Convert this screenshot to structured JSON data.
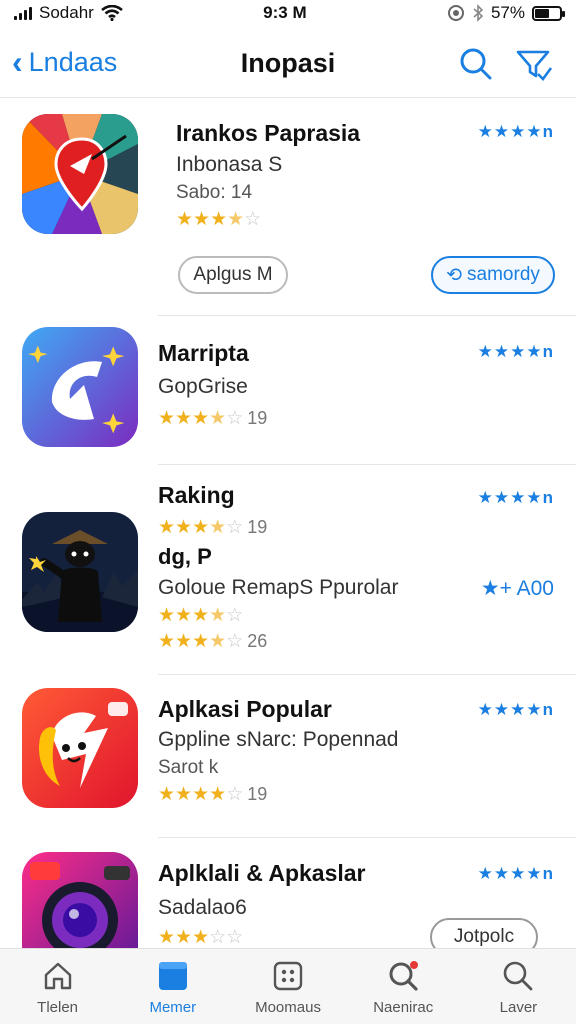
{
  "status_bar": {
    "carrier": "Sodahr",
    "time": "9:3 M",
    "battery": "57%",
    "battery_level": 0.57
  },
  "nav": {
    "back_label": "Lndaas",
    "title": "Inopasi",
    "icons": [
      "search-icon",
      "filter-icon"
    ]
  },
  "apps": [
    {
      "name": "Irankos Paprasia",
      "subtitle": "Inbonasa S",
      "meta": "Sabo: 14",
      "rating": 3.5,
      "rating_count": "",
      "rank": "★★★★n",
      "button_left": "Aplgus M",
      "button_right": "samordy"
    },
    {
      "name": "Marripta",
      "subtitle": "GopGrise",
      "rating": 3.5,
      "rating_count": "19",
      "rank": "★★★★n"
    },
    {
      "name": "Raking",
      "rating_line1": "19",
      "tag": "dg, P",
      "subtitle": "Goloue RemapS Ppurolar",
      "rating": 3.5,
      "rating_count": "26",
      "rank": "★★★★n",
      "side_label": "A00"
    },
    {
      "name": "Aplkasi Popular",
      "subtitle": "Gppline s​Narc: Popennad",
      "meta": "Sarot k",
      "rating": 4,
      "rating_count": "19",
      "rank": "★★★★n"
    },
    {
      "name": "Aplklali & Apkaslar",
      "subtitle": "Sadalao6",
      "rating": 3,
      "rating_count": "",
      "rank": "★★★★n",
      "button_right": "Jotpolc"
    }
  ],
  "tabs": [
    {
      "label": "Tlelen",
      "icon": "home-icon",
      "active": false
    },
    {
      "label": "Memer",
      "icon": "apps-icon",
      "active": true
    },
    {
      "label": "Moomaus",
      "icon": "grid-icon",
      "active": false
    },
    {
      "label": "Naenirac",
      "icon": "search-badge-icon",
      "active": false
    },
    {
      "label": "Laver",
      "icon": "search-icon",
      "active": false
    }
  ],
  "colors": {
    "accent": "#1a7fe0",
    "star": "#f0b11c",
    "tab_bg": "#f6f6f6"
  }
}
